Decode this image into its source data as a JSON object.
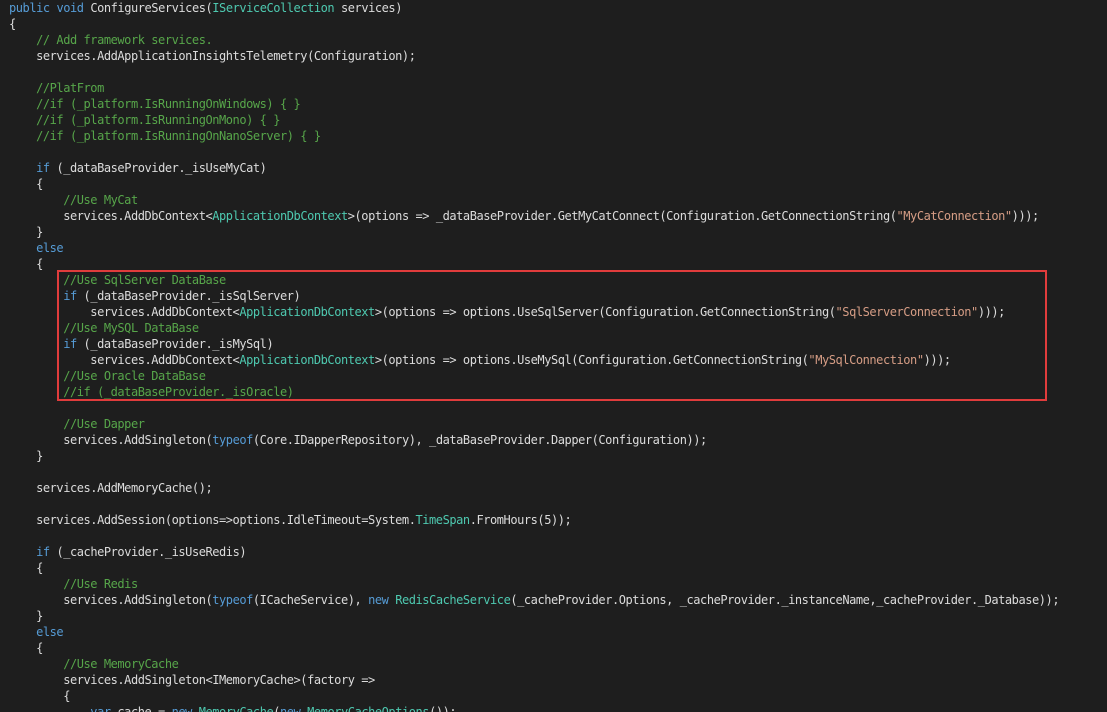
{
  "theme": {
    "background": "#1e1e1e",
    "keyword_color": "#569cd6",
    "comment_color": "#57a64a",
    "type_color": "#4ec9b0",
    "string_color": "#d69d85",
    "text_color": "#dcdcdc",
    "highlight_border_color": "#e03c3c"
  },
  "code": {
    "lines": [
      {
        "tokens": [
          {
            "t": "kw",
            "v": "public"
          },
          {
            "t": "tx",
            "v": " "
          },
          {
            "t": "kw",
            "v": "void"
          },
          {
            "t": "tx",
            "v": " ConfigureServices("
          },
          {
            "t": "ty",
            "v": "IServiceCollection"
          },
          {
            "t": "tx",
            "v": " services)"
          }
        ]
      },
      {
        "tokens": [
          {
            "t": "tx",
            "v": "{"
          }
        ]
      },
      {
        "tokens": [
          {
            "t": "cm",
            "v": "    // Add framework services."
          }
        ]
      },
      {
        "tokens": [
          {
            "t": "tx",
            "v": "    services.AddApplicationInsightsTelemetry(Configuration);"
          }
        ]
      },
      {
        "tokens": []
      },
      {
        "tokens": [
          {
            "t": "cm",
            "v": "    //PlatFrom"
          }
        ]
      },
      {
        "tokens": [
          {
            "t": "cm",
            "v": "    //if (_platform.IsRunningOnWindows) { }"
          }
        ]
      },
      {
        "tokens": [
          {
            "t": "cm",
            "v": "    //if (_platform.IsRunningOnMono) { }"
          }
        ]
      },
      {
        "tokens": [
          {
            "t": "cm",
            "v": "    //if (_platform.IsRunningOnNanoServer) { }"
          }
        ]
      },
      {
        "tokens": []
      },
      {
        "tokens": [
          {
            "t": "tx",
            "v": "    "
          },
          {
            "t": "kw",
            "v": "if"
          },
          {
            "t": "tx",
            "v": " (_dataBaseProvider._isUseMyCat)"
          }
        ]
      },
      {
        "tokens": [
          {
            "t": "tx",
            "v": "    {"
          }
        ]
      },
      {
        "tokens": [
          {
            "t": "cm",
            "v": "        //Use MyCat"
          }
        ]
      },
      {
        "tokens": [
          {
            "t": "tx",
            "v": "        services.AddDbContext<"
          },
          {
            "t": "ty",
            "v": "ApplicationDbContext"
          },
          {
            "t": "tx",
            "v": ">(options => _dataBaseProvider.GetMyCatConnect(Configuration.GetConnectionString("
          },
          {
            "t": "st",
            "v": "\"MyCatConnection\""
          },
          {
            "t": "tx",
            "v": ")));"
          }
        ]
      },
      {
        "tokens": [
          {
            "t": "tx",
            "v": "    }"
          }
        ]
      },
      {
        "tokens": [
          {
            "t": "tx",
            "v": "    "
          },
          {
            "t": "kw",
            "v": "else"
          }
        ]
      },
      {
        "tokens": [
          {
            "t": "tx",
            "v": "    {"
          }
        ]
      },
      {
        "tokens": [
          {
            "t": "cm",
            "v": "        //Use SqlServer DataBase"
          }
        ]
      },
      {
        "tokens": [
          {
            "t": "tx",
            "v": "        "
          },
          {
            "t": "kw",
            "v": "if"
          },
          {
            "t": "tx",
            "v": " (_dataBaseProvider._isSqlServer)"
          }
        ]
      },
      {
        "tokens": [
          {
            "t": "tx",
            "v": "            services.AddDbContext<"
          },
          {
            "t": "ty",
            "v": "ApplicationDbContext"
          },
          {
            "t": "tx",
            "v": ">(options => options.UseSqlServer(Configuration.GetConnectionString("
          },
          {
            "t": "st",
            "v": "\"SqlServerConnection\""
          },
          {
            "t": "tx",
            "v": ")));"
          }
        ]
      },
      {
        "tokens": [
          {
            "t": "cm",
            "v": "        //Use MySQL DataBase"
          }
        ]
      },
      {
        "tokens": [
          {
            "t": "tx",
            "v": "        "
          },
          {
            "t": "kw",
            "v": "if"
          },
          {
            "t": "tx",
            "v": " (_dataBaseProvider._isMySql)"
          }
        ]
      },
      {
        "tokens": [
          {
            "t": "tx",
            "v": "            services.AddDbContext<"
          },
          {
            "t": "ty",
            "v": "ApplicationDbContext"
          },
          {
            "t": "tx",
            "v": ">(options => options.UseMySql(Configuration.GetConnectionString("
          },
          {
            "t": "st",
            "v": "\"MySqlConnection\""
          },
          {
            "t": "tx",
            "v": ")));"
          }
        ]
      },
      {
        "tokens": [
          {
            "t": "cm",
            "v": "        //Use Oracle DataBase"
          }
        ]
      },
      {
        "tokens": [
          {
            "t": "cm",
            "v": "        //if (_dataBaseProvider._isOracle)"
          }
        ]
      },
      {
        "tokens": []
      },
      {
        "tokens": [
          {
            "t": "cm",
            "v": "        //Use Dapper"
          }
        ]
      },
      {
        "tokens": [
          {
            "t": "tx",
            "v": "        services.AddSingleton("
          },
          {
            "t": "kw",
            "v": "typeof"
          },
          {
            "t": "tx",
            "v": "(Core.IDapperRepository), _dataBaseProvider.Dapper(Configuration));"
          }
        ]
      },
      {
        "tokens": [
          {
            "t": "tx",
            "v": "    }"
          }
        ]
      },
      {
        "tokens": []
      },
      {
        "tokens": [
          {
            "t": "tx",
            "v": "    services.AddMemoryCache();"
          }
        ]
      },
      {
        "tokens": []
      },
      {
        "tokens": [
          {
            "t": "tx",
            "v": "    services.AddSession(options=>options.IdleTimeout=System."
          },
          {
            "t": "ty",
            "v": "TimeSpan"
          },
          {
            "t": "tx",
            "v": ".FromHours(5));"
          }
        ]
      },
      {
        "tokens": []
      },
      {
        "tokens": [
          {
            "t": "tx",
            "v": "    "
          },
          {
            "t": "kw",
            "v": "if"
          },
          {
            "t": "tx",
            "v": " (_cacheProvider._isUseRedis)"
          }
        ]
      },
      {
        "tokens": [
          {
            "t": "tx",
            "v": "    {"
          }
        ]
      },
      {
        "tokens": [
          {
            "t": "cm",
            "v": "        //Use Redis"
          }
        ]
      },
      {
        "tokens": [
          {
            "t": "tx",
            "v": "        services.AddSingleton("
          },
          {
            "t": "kw",
            "v": "typeof"
          },
          {
            "t": "tx",
            "v": "(ICacheService), "
          },
          {
            "t": "kw",
            "v": "new"
          },
          {
            "t": "tx",
            "v": " "
          },
          {
            "t": "ty",
            "v": "RedisCacheService"
          },
          {
            "t": "tx",
            "v": "(_cacheProvider.Options, _cacheProvider._instanceName,_cacheProvider._Database));"
          }
        ]
      },
      {
        "tokens": [
          {
            "t": "tx",
            "v": "    }"
          }
        ]
      },
      {
        "tokens": [
          {
            "t": "tx",
            "v": "    "
          },
          {
            "t": "kw",
            "v": "else"
          }
        ]
      },
      {
        "tokens": [
          {
            "t": "tx",
            "v": "    {"
          }
        ]
      },
      {
        "tokens": [
          {
            "t": "cm",
            "v": "        //Use MemoryCache"
          }
        ]
      },
      {
        "tokens": [
          {
            "t": "tx",
            "v": "        services.AddSingleton<IMemoryCache>(factory =>"
          }
        ]
      },
      {
        "tokens": [
          {
            "t": "tx",
            "v": "        {"
          }
        ]
      },
      {
        "tokens": [
          {
            "t": "tx",
            "v": "            "
          },
          {
            "t": "kw",
            "v": "var"
          },
          {
            "t": "tx",
            "v": " cache = "
          },
          {
            "t": "kw",
            "v": "new"
          },
          {
            "t": "tx",
            "v": " "
          },
          {
            "t": "ty",
            "v": "MemoryCache"
          },
          {
            "t": "tx",
            "v": "("
          },
          {
            "t": "kw",
            "v": "new"
          },
          {
            "t": "tx",
            "v": " "
          },
          {
            "t": "ty",
            "v": "MemoryCacheOptions"
          },
          {
            "t": "tx",
            "v": "());"
          }
        ]
      }
    ]
  }
}
